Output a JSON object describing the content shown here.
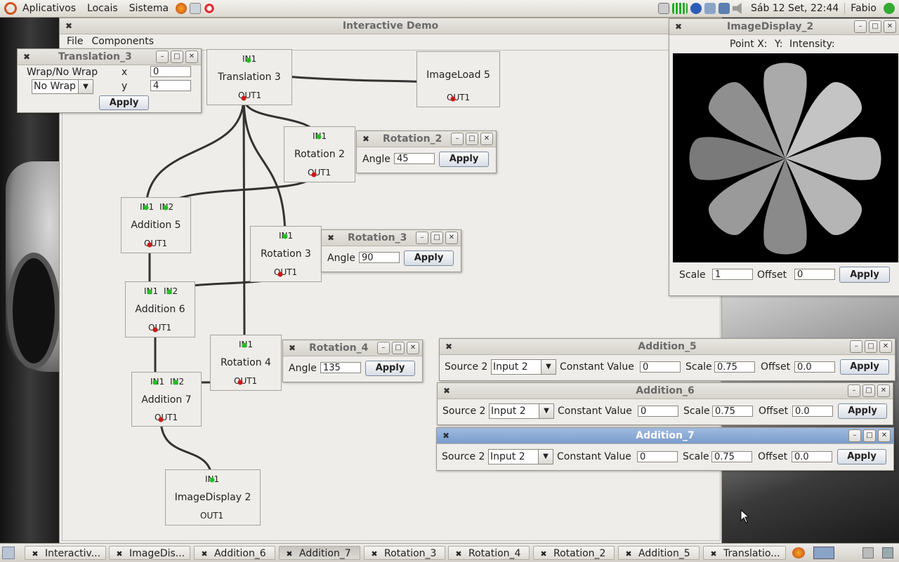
{
  "top_panel": {
    "menus": [
      "Aplicativos",
      "Locais",
      "Sistema"
    ],
    "clock": "Sáb 12 Set, 22:44",
    "user": "Fabio"
  },
  "main_window": {
    "title": "Interactive Demo",
    "menu": [
      "File",
      "Components"
    ]
  },
  "nodes": {
    "translation3": {
      "title": "Translation 3",
      "in1": "IN1",
      "out1": "OUT1"
    },
    "imageload5": {
      "title": "ImageLoad 5",
      "out1": "OUT1"
    },
    "rotation2": {
      "title": "Rotation 2",
      "in1": "IN1",
      "out1": "OUT1"
    },
    "addition5": {
      "title": "Addition 5",
      "in1": "IN1",
      "in2": "IN2",
      "out1": "OUT1"
    },
    "rotation3": {
      "title": "Rotation 3",
      "in1": "IN1",
      "out1": "OUT1"
    },
    "addition6": {
      "title": "Addition 6",
      "in1": "IN1",
      "in2": "IN2",
      "out1": "OUT1"
    },
    "rotation4": {
      "title": "Rotation 4",
      "in1": "IN1",
      "out1": "OUT1"
    },
    "addition7": {
      "title": "Addition 7",
      "in1": "IN1",
      "in2": "IN2",
      "out1": "OUT1"
    },
    "imagedisplay2": {
      "title": "ImageDisplay 2",
      "in1": "IN1",
      "out1": "OUT1"
    }
  },
  "translation_dialog": {
    "title": "Translation_3",
    "wrap_label": "Wrap/No Wrap",
    "wrap_value": "No Wrap",
    "x_label": "x",
    "x_value": "0",
    "y_label": "y",
    "y_value": "4",
    "apply": "Apply"
  },
  "rotation2_dialog": {
    "title": "Rotation_2",
    "angle_label": "Angle",
    "angle_value": "45",
    "apply": "Apply"
  },
  "rotation3_dialog": {
    "title": "Rotation_3",
    "angle_label": "Angle",
    "angle_value": "90",
    "apply": "Apply"
  },
  "rotation4_dialog": {
    "title": "Rotation_4",
    "angle_label": "Angle",
    "angle_value": "135",
    "apply": "Apply"
  },
  "image_display": {
    "title": "ImageDisplay_2",
    "point_x_label": "Point X:",
    "y_label": "Y:",
    "intensity_label": "Intensity:",
    "scale_label": "Scale",
    "scale_value": "1",
    "offset_label": "Offset",
    "offset_value": "0",
    "apply": "Apply"
  },
  "addition_dialogs": [
    {
      "title": "Addition_5",
      "source2_label": "Source 2",
      "source2_value": "Input 2",
      "constant_label": "Constant Value",
      "constant_value": "0",
      "scale_label": "Scale",
      "scale_value": "0.75",
      "offset_label": "Offset",
      "offset_value": "0.0",
      "apply": "Apply"
    },
    {
      "title": "Addition_6",
      "source2_label": "Source 2",
      "source2_value": "Input 2",
      "constant_label": "Constant Value",
      "constant_value": "0",
      "scale_label": "Scale",
      "scale_value": "0.75",
      "offset_label": "Offset",
      "offset_value": "0.0",
      "apply": "Apply"
    },
    {
      "title": "Addition_7",
      "source2_label": "Source 2",
      "source2_value": "Input 2",
      "constant_label": "Constant Value",
      "constant_value": "0",
      "scale_label": "Scale",
      "scale_value": "0.75",
      "offset_label": "Offset",
      "offset_value": "0.0",
      "apply": "Apply"
    }
  ],
  "taskbar": [
    "Interactiv...",
    "ImageDis...",
    "Addition_6",
    "Addition_7",
    "Rotation_3",
    "Rotation_4",
    "Rotation_2",
    "Addition_5",
    "Translatio..."
  ],
  "colors": {
    "pin_in": "#22c022",
    "pin_out": "#cc1a1a",
    "wire": "#333333",
    "active_title": "#7a9ccb"
  }
}
